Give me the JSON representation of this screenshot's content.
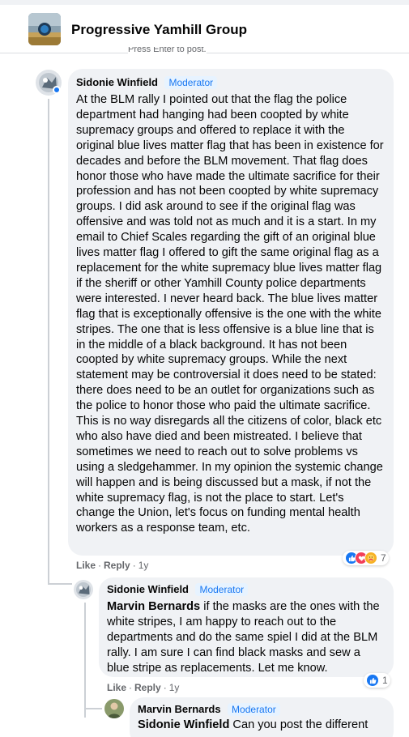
{
  "header": {
    "group_name": "Progressive Yamhill Group",
    "hint_text": "Press Enter to post."
  },
  "comments": [
    {
      "author": "Sidonie Winfield",
      "role": "Moderator",
      "text": "At the BLM rally I pointed out that the flag the police department had hanging had been coopted by white supremacy groups and offered to replace it with the original blue lives matter flag that has been in existence for decades and before the BLM movement. That flag does honor those who have made the ultimate sacrifice for their profession and has not been coopted by white supremacy groups. I did ask around to see if the original flag was offensive and was told not as much and it is a start. In my email to Chief Scales regarding the gift of an original blue lives matter flag I offered to gift the same original flag as a replacement for the white supremacy blue lives matter flag if the sheriff or other Yamhill County police departments were interested. I never heard back. The blue lives matter flag that is exceptionally offensive is the one with the white stripes. The one that is less offensive is a blue line that is in the middle of a black background. It has not been coopted by white supremacy groups. While the next statement may be controversial it does need to be stated: there does need to be an outlet for organizations such as the police to honor those who paid the ultimate sacrifice. This is no way disregards all the citizens of color, black etc who also have died and been mistreated. I believe that sometimes we need to reach out to solve problems vs using a sledgehammer. In my opinion the systemic change will happen and is being discussed but a mask, if not the white supremacy flag, is not the place to start. Let's change the Union, let's focus on funding mental health workers as a response team, etc.",
      "like_label": "Like",
      "reply_label": "Reply",
      "age": "1y",
      "reaction_count": "7",
      "reaction_icons": [
        "like-reaction-icon",
        "love-reaction-icon",
        "care-reaction-icon"
      ]
    },
    {
      "author": "Sidonie Winfield",
      "role": "Moderator",
      "mention": "Marvin Bernards",
      "text": " if the masks are the ones with the white stripes, I am happy to reach out to the departments and do the same spiel I did at the BLM rally. I am sure I can find black masks and sew a blue stripe as replacements. Let me know.",
      "like_label": "Like",
      "reply_label": "Reply",
      "age": "1y",
      "reaction_count": "1",
      "reaction_icons": [
        "like-reaction-icon"
      ]
    },
    {
      "author": "Marvin Bernards",
      "role": "Moderator",
      "mention": "Sidonie Winfield",
      "text": " Can you post the different"
    }
  ],
  "colors": {
    "accent": "#1877f2",
    "bubble": "#f0f2f5",
    "muted": "#65676b",
    "love": "#f33e58",
    "care": "#f7b125"
  }
}
